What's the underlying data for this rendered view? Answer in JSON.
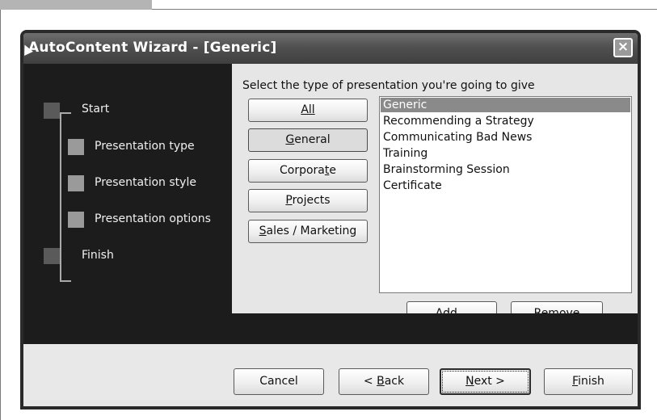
{
  "window": {
    "title": "AutoContent Wizard - [Generic]",
    "close_icon": "×"
  },
  "steps": [
    {
      "label": "Start",
      "state": "completed"
    },
    {
      "label": "Presentation type",
      "state": "current"
    },
    {
      "label": "Presentation style",
      "state": "pending"
    },
    {
      "label": "Presentation options",
      "state": "pending"
    },
    {
      "label": "Finish",
      "state": "pending"
    }
  ],
  "main": {
    "prompt": "Select the type of presentation you're going to give",
    "categories": [
      {
        "label": "All",
        "mnemonic": "A"
      },
      {
        "label": "General",
        "mnemonic": "G"
      },
      {
        "label": "Corporate",
        "mnemonic": "t"
      },
      {
        "label": "Projects",
        "mnemonic": "P"
      },
      {
        "label": "Sales / Marketing",
        "mnemonic": "S"
      }
    ],
    "selected_category": "General",
    "presentations": [
      "Generic",
      "Recommending a Strategy",
      "Communicating Bad News",
      "Training",
      "Brainstorming Session",
      "Certificate"
    ],
    "selected_presentation": "Generic",
    "add_label": "Add...",
    "remove_label": "Remove"
  },
  "footer": {
    "cancel": "Cancel",
    "back": "< Back",
    "next": "Next >",
    "finish": "Finish"
  }
}
